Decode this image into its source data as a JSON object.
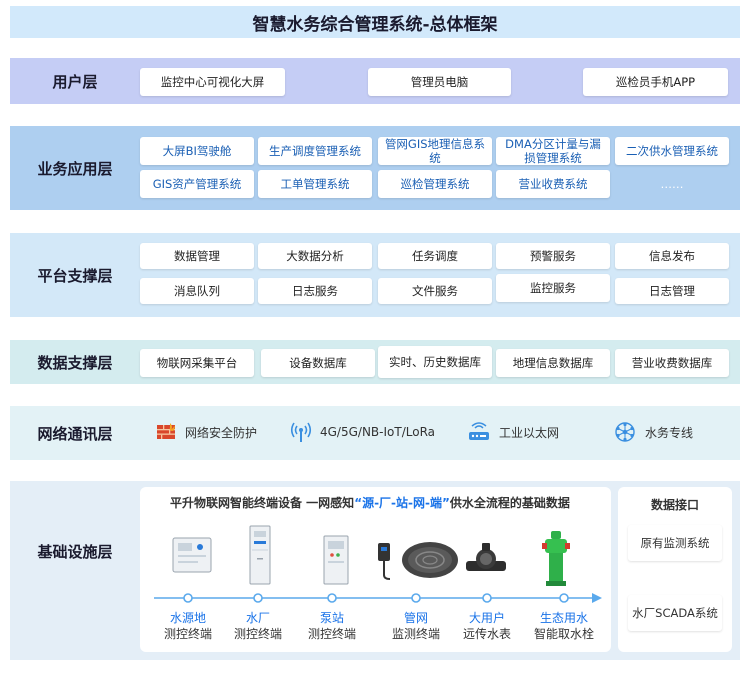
{
  "title": "智慧水务综合管理系统-总体框架",
  "colors": {
    "user_bg": "#c5cdf5",
    "app_bg": "#aecff0",
    "platform_bg": "#d3e8f8",
    "data_bg": "#d4ecef",
    "net_bg": "#e3f2f6",
    "infra_bg": "#e4eef7"
  },
  "user_layer": {
    "label": "用户层",
    "items": [
      "监控中心可视化大屏",
      "管理员电脑",
      "巡检员手机APP"
    ]
  },
  "app_layer": {
    "label": "业务应用层",
    "row1": [
      "大屏BI驾驶舱",
      "生产调度管理系统",
      "管网GIS地理信息系统",
      "DMA分区计量与漏损管理系统",
      "二次供水管理系统"
    ],
    "row2": [
      "GIS资产管理系统",
      "工单管理系统",
      "巡检管理系统",
      "营业收费系统",
      "……"
    ]
  },
  "platform_layer": {
    "label": "平台支撑层",
    "row1": [
      "数据管理",
      "大数据分析",
      "任务调度",
      "预警服务",
      "信息发布"
    ],
    "row2": [
      "消息队列",
      "日志服务",
      "文件服务",
      "监控服务",
      "日志管理"
    ]
  },
  "data_layer": {
    "label": "数据支撑层",
    "items": [
      "物联网采集平台",
      "设备数据库",
      "实时、历史数据库",
      "地理信息数据库",
      "营业收费数据库"
    ]
  },
  "network_layer": {
    "label": "网络通讯层",
    "items": [
      {
        "icon": "firewall-icon",
        "label": "网络安全防护"
      },
      {
        "icon": "wireless-signal-icon",
        "label": "4G/5G/NB-IoT/LoRa"
      },
      {
        "icon": "router-icon",
        "label": "工业以太网"
      },
      {
        "icon": "network-hub-icon",
        "label": "水务专线"
      }
    ]
  },
  "infra_layer": {
    "label": "基础设施层",
    "header_pre": "平升物联网智能终端设备  一网感知",
    "header_hl": "“源-厂-站-网-端”",
    "header_post": "供水全流程的基础数据",
    "devices": [
      {
        "icon": "control-cabinet-icon",
        "line1": "水源地",
        "line2": "测控终端"
      },
      {
        "icon": "tall-cabinet-icon",
        "line1": "水厂",
        "line2": "测控终端"
      },
      {
        "icon": "pump-cabinet-icon",
        "line1": "泵站",
        "line2": "测控终端"
      },
      {
        "icon": "pipe-network-terminal-icon",
        "line1": "管网",
        "line2": "监测终端"
      },
      {
        "icon": "water-meter-icon",
        "line1": "大用户",
        "line2": "远传水表"
      },
      {
        "icon": "hydrant-icon",
        "line1": "生态用水",
        "line2": "智能取水栓"
      }
    ],
    "interface_title": "数据接口",
    "interfaces": [
      "原有监测系统",
      "水厂SCADA系统"
    ]
  }
}
